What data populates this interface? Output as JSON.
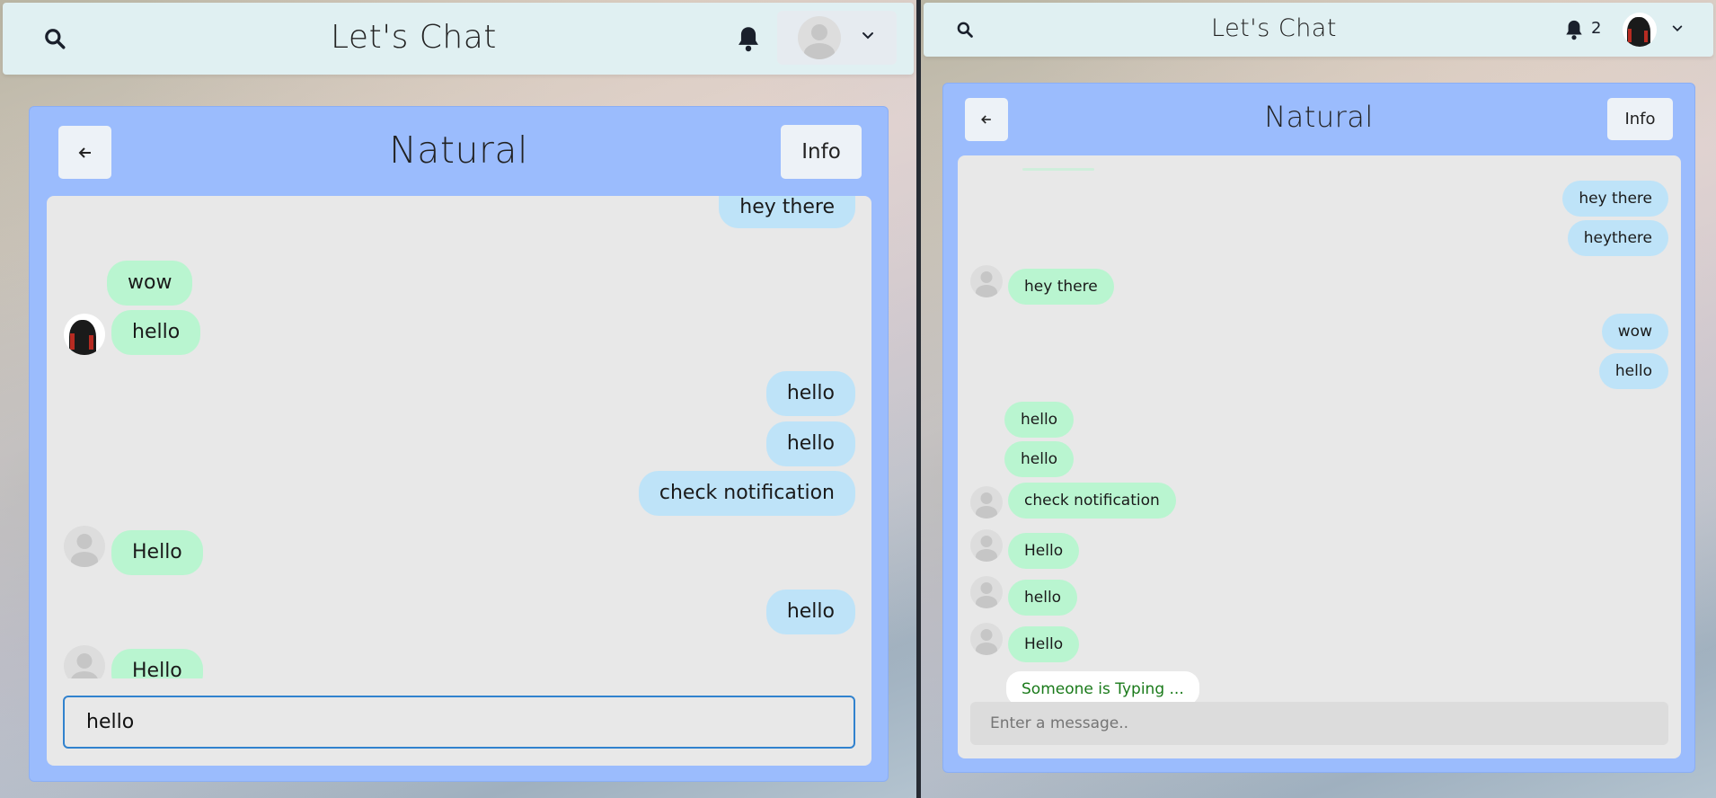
{
  "app": {
    "title": "Let's Chat"
  },
  "left": {
    "chat_title": "Natural",
    "info_label": "Info",
    "input_value": "hello",
    "messages": [
      {
        "text": "hey there"
      },
      {
        "text": "wow"
      },
      {
        "text": "hello"
      },
      {
        "text": "hello"
      },
      {
        "text": "hello"
      },
      {
        "text": "check notification"
      },
      {
        "text": "Hello"
      },
      {
        "text": "hello"
      },
      {
        "text": "Hello"
      }
    ]
  },
  "right": {
    "chat_title": "Natural",
    "info_label": "Info",
    "notification_count": "2",
    "input_placeholder": "Enter a message..",
    "typing": "Someone is Typing ...",
    "messages": [
      {
        "text": "hey there"
      },
      {
        "text": "heythere"
      },
      {
        "text": "hey there"
      },
      {
        "text": "wow"
      },
      {
        "text": "hello"
      },
      {
        "text": "hello"
      },
      {
        "text": "hello"
      },
      {
        "text": "check notification"
      },
      {
        "text": "Hello"
      },
      {
        "text": "hello"
      },
      {
        "text": "Hello"
      }
    ]
  },
  "colors": {
    "panel": "#9bbcfd",
    "sent": "#bee3f8",
    "received": "#b9f5d0",
    "topbar": "#e0f0f2"
  },
  "icons": [
    "search-icon",
    "bell-icon",
    "chevron-down-icon",
    "arrow-left-icon"
  ]
}
